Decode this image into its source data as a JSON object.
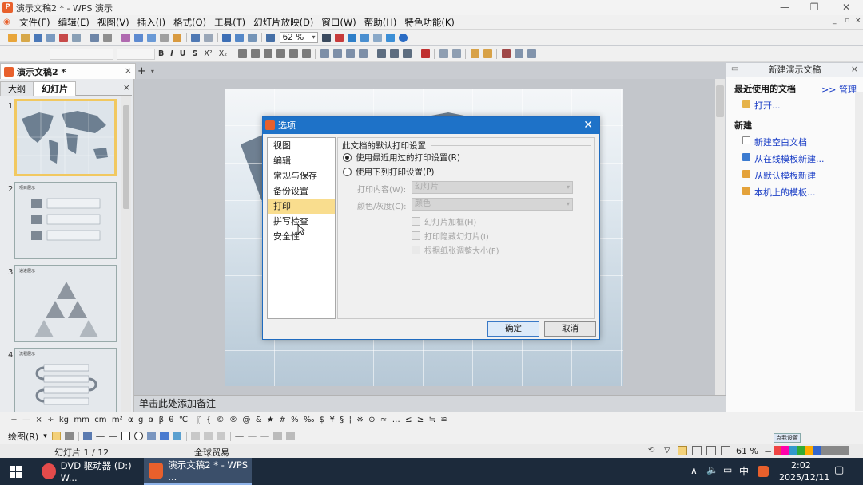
{
  "titlebar": {
    "title": "演示文稿2 * - WPS 演示"
  },
  "menubar": {
    "items": [
      "文件(F)",
      "编辑(E)",
      "视图(V)",
      "插入(I)",
      "格式(O)",
      "工具(T)",
      "幻灯片放映(D)",
      "窗口(W)",
      "帮助(H)",
      "特色功能(K)"
    ]
  },
  "toolbar": {
    "zoom": "62 %"
  },
  "format_bar": {
    "buttons": [
      "B",
      "I",
      "U",
      "S",
      "X²",
      "X₂"
    ]
  },
  "doc_tab": {
    "title": "演示文稿2 *",
    "close": "×",
    "add": "+"
  },
  "left_panel": {
    "tabs": [
      "大纲",
      "幻灯片"
    ],
    "slides": [
      {
        "num": "1",
        "title": ""
      },
      {
        "num": "2",
        "title": "项目展示"
      },
      {
        "num": "3",
        "title": "递进展示"
      },
      {
        "num": "4",
        "title": "流程展示"
      }
    ]
  },
  "notes": {
    "placeholder": "单击此处添加备注"
  },
  "task_pane": {
    "header": "新建演示文稿",
    "recent_label": "最近使用的文档",
    "manage": ">> 管理",
    "open": "打开...",
    "new_label": "新建",
    "links": [
      "新建空白文档",
      "从在线模板新建...",
      "从默认模板新建",
      "本机上的模板..."
    ]
  },
  "dialog": {
    "title": "选项",
    "categories": [
      "视图",
      "编辑",
      "常规与保存",
      "备份设置",
      "打印",
      "拼写检查",
      "安全性"
    ],
    "selected": "打印",
    "group_title": "此文档的默认打印设置",
    "radio1": "使用最近用过的打印设置(R)",
    "radio2": "使用下列打印设置(P)",
    "print_content_label": "打印内容(W):",
    "print_content_value": "幻灯片",
    "color_label": "颜色/灰度(C):",
    "color_value": "颜色",
    "chk1": "幻灯片加框(H)",
    "chk2": "打印隐藏幻灯片(I)",
    "chk3": "根据纸张调整大小(F)",
    "ok": "确定",
    "cancel": "取消"
  },
  "symbols": [
    "+",
    "—",
    "×",
    "÷",
    "kg",
    "mm",
    "cm",
    "m²",
    "α",
    "g",
    "α",
    "β",
    "θ",
    "℃",
    "〖",
    "{",
    "©",
    "®",
    "@",
    "&",
    "★",
    "#",
    "%",
    "‰",
    "$",
    "¥",
    "§",
    "¦",
    "※",
    "⊙",
    "≈",
    "…",
    "≤",
    "≥",
    "≒",
    "≌"
  ],
  "drawbar": {
    "label": "绘图(R)"
  },
  "statusbar": {
    "slide": "幻灯片 1 / 12",
    "theme": "全球贸易",
    "zoom": "61 %",
    "badge": "点我设置"
  },
  "taskbar": {
    "items": [
      "DVD 驱动器 (D:) W...",
      "演示文稿2 * - WPS ..."
    ],
    "tray_lang": "中",
    "time": "2:02",
    "date": "2025/12/11"
  },
  "colors": {
    "accent": "#1e72c8",
    "wps_orange": "#e8602c",
    "selected_item": "#f9dd8e",
    "link": "#1a3ec6"
  }
}
